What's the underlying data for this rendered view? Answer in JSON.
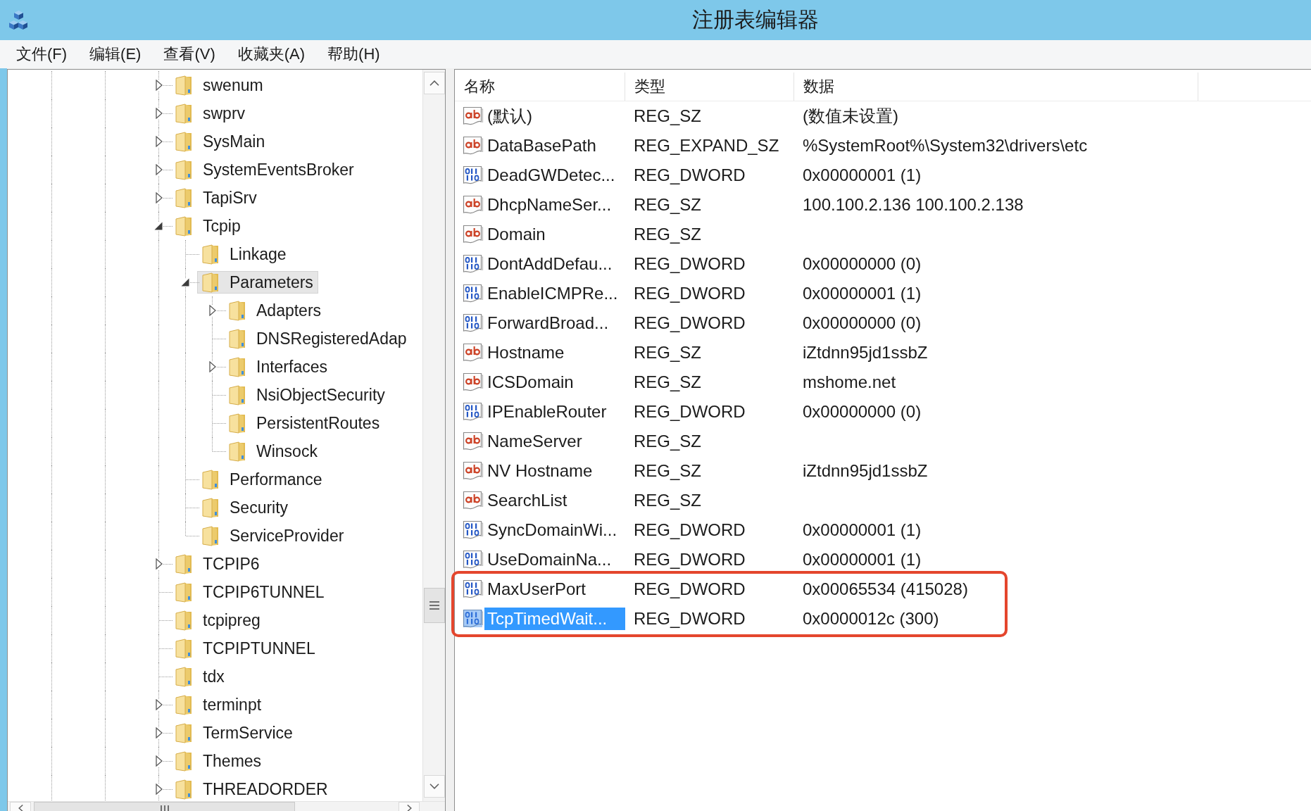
{
  "window": {
    "title": "注册表编辑器"
  },
  "menu_bar": {
    "items": [
      "文件(F)",
      "编辑(E)",
      "查看(V)",
      "收藏夹(A)",
      "帮助(H)"
    ]
  },
  "tree": {
    "items": [
      {
        "label": "swenum",
        "kind": "branch",
        "expanded": false,
        "selected": false
      },
      {
        "label": "swprv",
        "kind": "branch",
        "expanded": false,
        "selected": false
      },
      {
        "label": "SysMain",
        "kind": "branch",
        "expanded": false,
        "selected": false
      },
      {
        "label": "SystemEventsBroker",
        "kind": "branch",
        "expanded": false,
        "selected": false
      },
      {
        "label": "TapiSrv",
        "kind": "branch",
        "expanded": false,
        "selected": false
      },
      {
        "label": "Tcpip",
        "kind": "branch",
        "expanded": true,
        "selected": false,
        "children": [
          {
            "label": "Linkage",
            "kind": "leaf",
            "selected": false
          },
          {
            "label": "Parameters",
            "kind": "branch",
            "expanded": true,
            "selected": true,
            "children": [
              {
                "label": "Adapters",
                "kind": "branch",
                "expanded": false,
                "selected": false
              },
              {
                "label": "DNSRegisteredAdap",
                "kind": "leaf",
                "selected": false
              },
              {
                "label": "Interfaces",
                "kind": "branch",
                "expanded": false,
                "selected": false
              },
              {
                "label": "NsiObjectSecurity",
                "kind": "leaf",
                "selected": false
              },
              {
                "label": "PersistentRoutes",
                "kind": "leaf",
                "selected": false
              },
              {
                "label": "Winsock",
                "kind": "leaf",
                "selected": false
              }
            ]
          },
          {
            "label": "Performance",
            "kind": "leaf",
            "selected": false
          },
          {
            "label": "Security",
            "kind": "leaf",
            "selected": false
          },
          {
            "label": "ServiceProvider",
            "kind": "leaf",
            "selected": false
          }
        ]
      },
      {
        "label": "TCPIP6",
        "kind": "branch",
        "expanded": false,
        "selected": false
      },
      {
        "label": "TCPIP6TUNNEL",
        "kind": "leaf",
        "selected": false
      },
      {
        "label": "tcpipreg",
        "kind": "leaf",
        "selected": false
      },
      {
        "label": "TCPIPTUNNEL",
        "kind": "leaf",
        "selected": false
      },
      {
        "label": "tdx",
        "kind": "leaf",
        "selected": false
      },
      {
        "label": "terminpt",
        "kind": "branch",
        "expanded": false,
        "selected": false
      },
      {
        "label": "TermService",
        "kind": "branch",
        "expanded": false,
        "selected": false
      },
      {
        "label": "Themes",
        "kind": "branch",
        "expanded": false,
        "selected": false
      },
      {
        "label": "THREADORDER",
        "kind": "branch",
        "expanded": false,
        "selected": false
      }
    ]
  },
  "values": {
    "columns": [
      "名称",
      "类型",
      "数据"
    ],
    "rows": [
      {
        "name": "(默认)",
        "kind": "string",
        "type": "REG_SZ",
        "data": "(数值未设置)",
        "selected": false,
        "boxed": false
      },
      {
        "name": "DataBasePath",
        "kind": "string",
        "type": "REG_EXPAND_SZ",
        "data": "%SystemRoot%\\System32\\drivers\\etc",
        "selected": false,
        "boxed": false
      },
      {
        "name": "DeadGWDetec...",
        "kind": "dword",
        "type": "REG_DWORD",
        "data": "0x00000001 (1)",
        "selected": false,
        "boxed": false
      },
      {
        "name": "DhcpNameSer...",
        "kind": "string",
        "type": "REG_SZ",
        "data": "100.100.2.136 100.100.2.138",
        "selected": false,
        "boxed": false
      },
      {
        "name": "Domain",
        "kind": "string",
        "type": "REG_SZ",
        "selected": false,
        "boxed": false
      },
      {
        "name": "DontAddDefau...",
        "kind": "dword",
        "type": "REG_DWORD",
        "data": "0x00000000 (0)",
        "selected": false,
        "boxed": false
      },
      {
        "name": "EnableICMPRe...",
        "kind": "dword",
        "type": "REG_DWORD",
        "data": "0x00000001 (1)",
        "selected": false,
        "boxed": false
      },
      {
        "name": "ForwardBroad...",
        "kind": "dword",
        "type": "REG_DWORD",
        "data": "0x00000000 (0)",
        "selected": false,
        "boxed": false
      },
      {
        "name": "Hostname",
        "kind": "string",
        "type": "REG_SZ",
        "data": "iZtdnn95jd1ssbZ",
        "selected": false,
        "boxed": false
      },
      {
        "name": "ICSDomain",
        "kind": "string",
        "type": "REG_SZ",
        "data": "mshome.net",
        "selected": false,
        "boxed": false
      },
      {
        "name": "IPEnableRouter",
        "kind": "dword",
        "type": "REG_DWORD",
        "data": "0x00000000 (0)",
        "selected": false,
        "boxed": false
      },
      {
        "name": "NameServer",
        "kind": "string",
        "type": "REG_SZ",
        "selected": false,
        "boxed": false
      },
      {
        "name": "NV Hostname",
        "kind": "string",
        "type": "REG_SZ",
        "data": "iZtdnn95jd1ssbZ",
        "selected": false,
        "boxed": false
      },
      {
        "name": "SearchList",
        "kind": "string",
        "type": "REG_SZ",
        "selected": false,
        "boxed": false
      },
      {
        "name": "SyncDomainWi...",
        "kind": "dword",
        "type": "REG_DWORD",
        "data": "0x00000001 (1)",
        "selected": false,
        "boxed": false
      },
      {
        "name": "UseDomainNa...",
        "kind": "dword",
        "type": "REG_DWORD",
        "data": "0x00000001 (1)",
        "selected": false,
        "boxed": false
      },
      {
        "name": "MaxUserPort",
        "kind": "dword",
        "type": "REG_DWORD",
        "data": "0x00065534 (415028)",
        "selected": false,
        "boxed": true
      },
      {
        "name": "TcpTimedWait...",
        "kind": "dword",
        "type": "REG_DWORD",
        "data": "0x0000012c (300)",
        "selected": true,
        "boxed": true
      }
    ]
  }
}
